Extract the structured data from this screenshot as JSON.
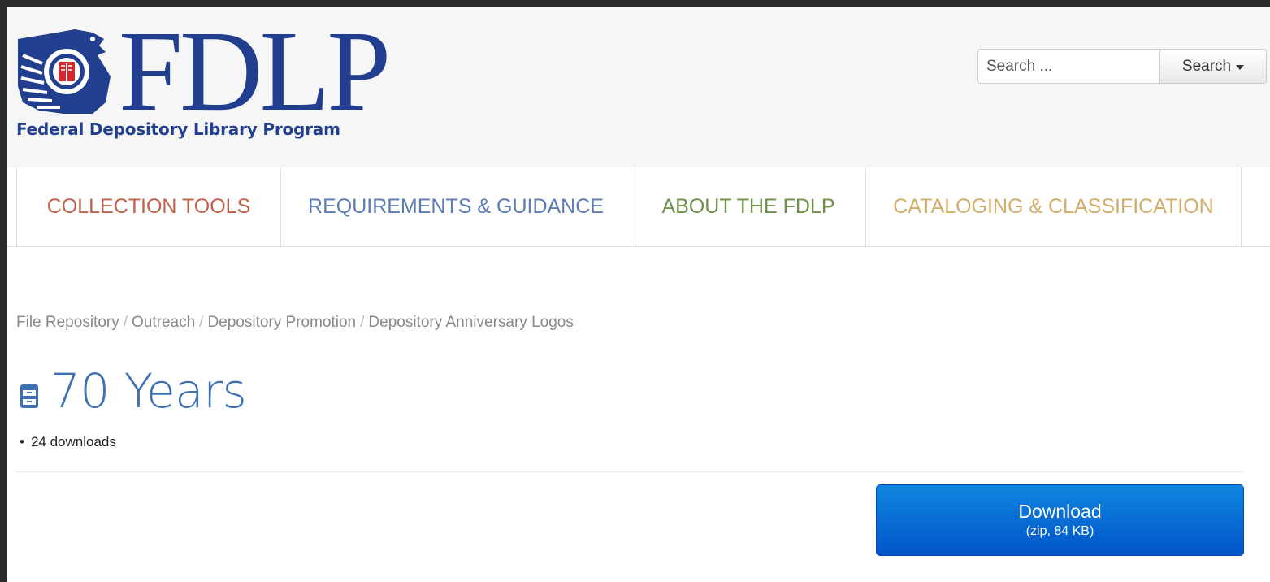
{
  "header": {
    "logo_text": "FDLP",
    "logo_subtitle": "Federal Depository Library Program",
    "brand_color": "#213e8f",
    "search": {
      "placeholder": "Search ...",
      "button_label": "Search"
    }
  },
  "nav": {
    "items": [
      {
        "label": "COLLECTION TOOLS",
        "color": "#c0614a"
      },
      {
        "label": "REQUIREMENTS & GUIDANCE",
        "color": "#5d7bb5"
      },
      {
        "label": "ABOUT THE FDLP",
        "color": "#6d9148"
      },
      {
        "label": "CATALOGING & CLASSIFICATION",
        "color": "#d2ad6a"
      }
    ]
  },
  "breadcrumb": {
    "items": [
      "File Repository",
      "Outreach",
      "Depository Promotion",
      "Depository Anniversary Logos"
    ],
    "separator": "/"
  },
  "page": {
    "title": "70 Years",
    "title_icon": "file-cabinet-icon",
    "downloads_text": "24 downloads"
  },
  "download": {
    "label": "Download",
    "info": "(zip, 84 KB)",
    "color": "#0a6fd8"
  }
}
